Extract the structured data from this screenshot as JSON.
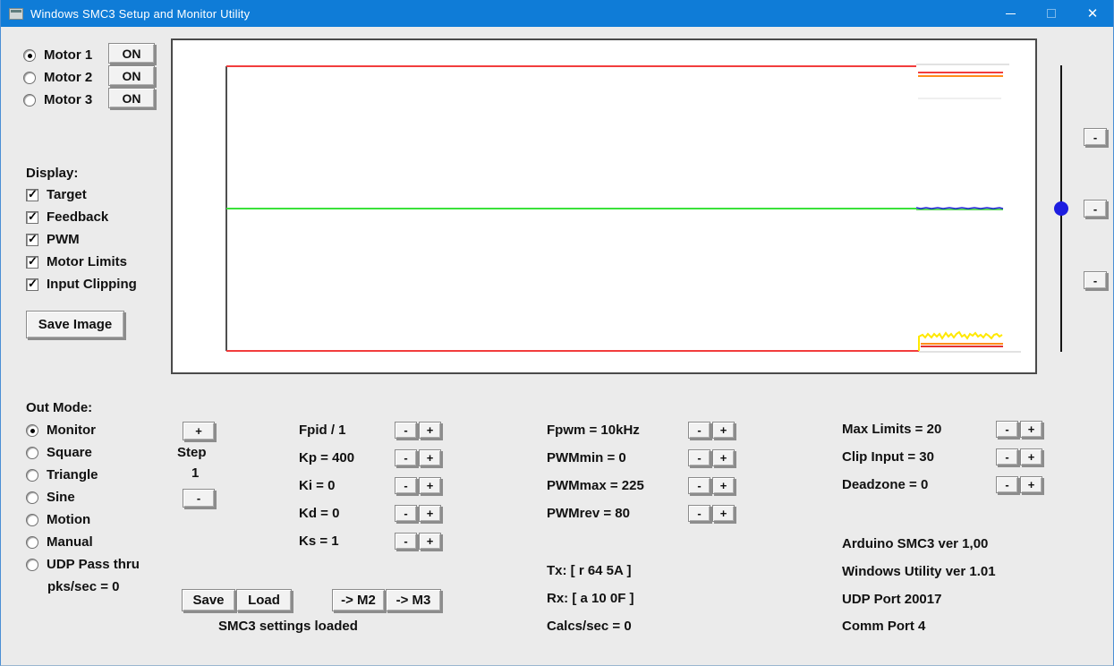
{
  "window": {
    "title": "Windows SMC3 Setup and Monitor Utility"
  },
  "titlebar": {
    "close_glyph": "✕"
  },
  "ui": {
    "minus": "-",
    "plus": "+"
  },
  "motors": {
    "items": [
      {
        "label": "Motor 1",
        "on_label": "ON",
        "selected": true
      },
      {
        "label": "Motor 2",
        "on_label": "ON",
        "selected": false
      },
      {
        "label": "Motor 3",
        "on_label": "ON",
        "selected": false
      }
    ]
  },
  "display": {
    "heading": "Display:",
    "save_image_label": "Save Image",
    "items": [
      {
        "label": "Target",
        "checked": true
      },
      {
        "label": "Feedback",
        "checked": true
      },
      {
        "label": "PWM",
        "checked": true
      },
      {
        "label": "Motor Limits",
        "checked": true
      },
      {
        "label": "Input Clipping",
        "checked": true
      }
    ]
  },
  "out_mode": {
    "heading": "Out Mode:",
    "pks_label": "pks/sec = 0",
    "items": [
      {
        "label": "Monitor",
        "selected": true
      },
      {
        "label": "Square",
        "selected": false
      },
      {
        "label": "Triangle",
        "selected": false
      },
      {
        "label": "Sine",
        "selected": false
      },
      {
        "label": "Motion",
        "selected": false
      },
      {
        "label": "Manual",
        "selected": false
      },
      {
        "label": "UDP Pass thru",
        "selected": false
      }
    ]
  },
  "step": {
    "heading": "Step",
    "value": "1"
  },
  "pid": {
    "rows": [
      {
        "label": "Fpid / 1"
      },
      {
        "label": "Kp = 400"
      },
      {
        "label": "Ki = 0"
      },
      {
        "label": "Kd = 0"
      },
      {
        "label": "Ks = 1"
      }
    ]
  },
  "pwm": {
    "rows": [
      {
        "label": "Fpwm = 10kHz"
      },
      {
        "label": "PWMmin = 0"
      },
      {
        "label": "PWMmax = 225"
      },
      {
        "label": "PWMrev = 80"
      }
    ]
  },
  "limits": {
    "rows": [
      {
        "label": "Max Limits = 20"
      },
      {
        "label": "Clip Input = 30"
      },
      {
        "label": "Deadzone = 0"
      }
    ]
  },
  "actions": {
    "save": "Save",
    "load": "Load",
    "to_m2": "-> M2",
    "to_m3": "-> M3",
    "status": "SMC3 settings loaded"
  },
  "comm": {
    "tx": "Tx: [ r 64 5A ]",
    "rx": "Rx: [ a 10 0F ]",
    "calcs": "Calcs/sec = 0"
  },
  "info": {
    "lines": [
      "Arduino SMC3 ver 1,00",
      "Windows Utility ver 1.01",
      "UDP Port 20017",
      "Comm Port 4"
    ]
  },
  "colors": {
    "titlebar_blue": "#0f7cd7",
    "limit_red": "#f23d3d",
    "clip_orange": "#ff8c1a",
    "target_green": "#3ae23a",
    "feedback_blue": "#2424dc",
    "pwm_yellow": "#ffe800",
    "history_gray": "#e2e2e2",
    "slider_thumb_blue": "#1d1de0"
  },
  "scope": {
    "traces": [
      {
        "name": "y-axis",
        "color": "#151515",
        "width": 1.5,
        "points": [
          [
            62,
            31
          ],
          [
            62,
            349
          ]
        ]
      },
      {
        "name": "top-limit-history-red",
        "color": "#f23d3d",
        "width": 2,
        "points": [
          [
            62,
            31
          ],
          [
            833,
            31
          ]
        ]
      },
      {
        "name": "top-history-gray",
        "color": "#e2e2e2",
        "width": 2,
        "points": [
          [
            833,
            29
          ],
          [
            937,
            29
          ]
        ]
      },
      {
        "name": "top-limit-current-red",
        "color": "#f23d3d",
        "width": 2,
        "points": [
          [
            835,
            38
          ],
          [
            930,
            38
          ]
        ]
      },
      {
        "name": "top-clip-current-orange",
        "color": "#ff8c1a",
        "width": 2,
        "points": [
          [
            835,
            42
          ],
          [
            930,
            42
          ]
        ]
      },
      {
        "name": "top-faint-gray",
        "color": "#efefef",
        "width": 2,
        "points": [
          [
            835,
            67
          ],
          [
            928,
            67
          ]
        ]
      },
      {
        "name": "target-green",
        "color": "#3ae23a",
        "width": 2,
        "points": [
          [
            62,
            190
          ],
          [
            833,
            190
          ]
        ]
      },
      {
        "name": "feedback-green-current",
        "color": "#2fca2f",
        "width": 1.5,
        "points": [
          [
            833,
            191
          ],
          [
            930,
            191
          ]
        ]
      },
      {
        "name": "feedback-blue",
        "color": "#2424dc",
        "width": 1.5,
        "points": [
          [
            833,
            189
          ],
          [
            838,
            190
          ],
          [
            844,
            189
          ],
          [
            850,
            190
          ],
          [
            857,
            189
          ],
          [
            863,
            190
          ],
          [
            870,
            189
          ],
          [
            877,
            190
          ],
          [
            884,
            189
          ],
          [
            891,
            190
          ],
          [
            898,
            189
          ],
          [
            905,
            190
          ],
          [
            912,
            189
          ],
          [
            919,
            190
          ],
          [
            926,
            189
          ],
          [
            930,
            190
          ]
        ]
      },
      {
        "name": "bottom-limit-history-red",
        "color": "#f23d3d",
        "width": 2,
        "points": [
          [
            62,
            349
          ],
          [
            836,
            349
          ]
        ]
      },
      {
        "name": "bottom-history-gray",
        "color": "#e2e2e2",
        "width": 2,
        "points": [
          [
            836,
            350
          ],
          [
            950,
            350
          ]
        ]
      },
      {
        "name": "bottom-limit-current-red",
        "color": "#e33030",
        "width": 2,
        "points": [
          [
            838,
            344
          ],
          [
            930,
            344
          ]
        ]
      },
      {
        "name": "bottom-clip-current-orange",
        "color": "#ff8c1a",
        "width": 2,
        "points": [
          [
            838,
            341
          ],
          [
            930,
            341
          ]
        ]
      },
      {
        "name": "pwm-yellow",
        "color": "#ffe800",
        "width": 2,
        "points": [
          [
            836,
            349
          ],
          [
            836,
            333
          ],
          [
            840,
            331
          ],
          [
            843,
            334
          ],
          [
            846,
            330
          ],
          [
            850,
            334
          ],
          [
            853,
            330
          ],
          [
            856,
            333
          ],
          [
            859,
            330
          ],
          [
            862,
            335
          ],
          [
            866,
            329
          ],
          [
            869,
            333
          ],
          [
            872,
            330
          ],
          [
            875,
            334
          ],
          [
            878,
            330
          ],
          [
            881,
            328
          ],
          [
            884,
            333
          ],
          [
            887,
            331
          ],
          [
            890,
            335
          ],
          [
            893,
            330
          ],
          [
            896,
            332
          ],
          [
            899,
            329
          ],
          [
            902,
            333
          ],
          [
            905,
            331
          ],
          [
            908,
            334
          ],
          [
            911,
            330
          ],
          [
            914,
            332
          ],
          [
            917,
            335
          ],
          [
            920,
            331
          ],
          [
            923,
            330
          ],
          [
            926,
            333
          ],
          [
            929,
            331
          ]
        ]
      }
    ]
  }
}
